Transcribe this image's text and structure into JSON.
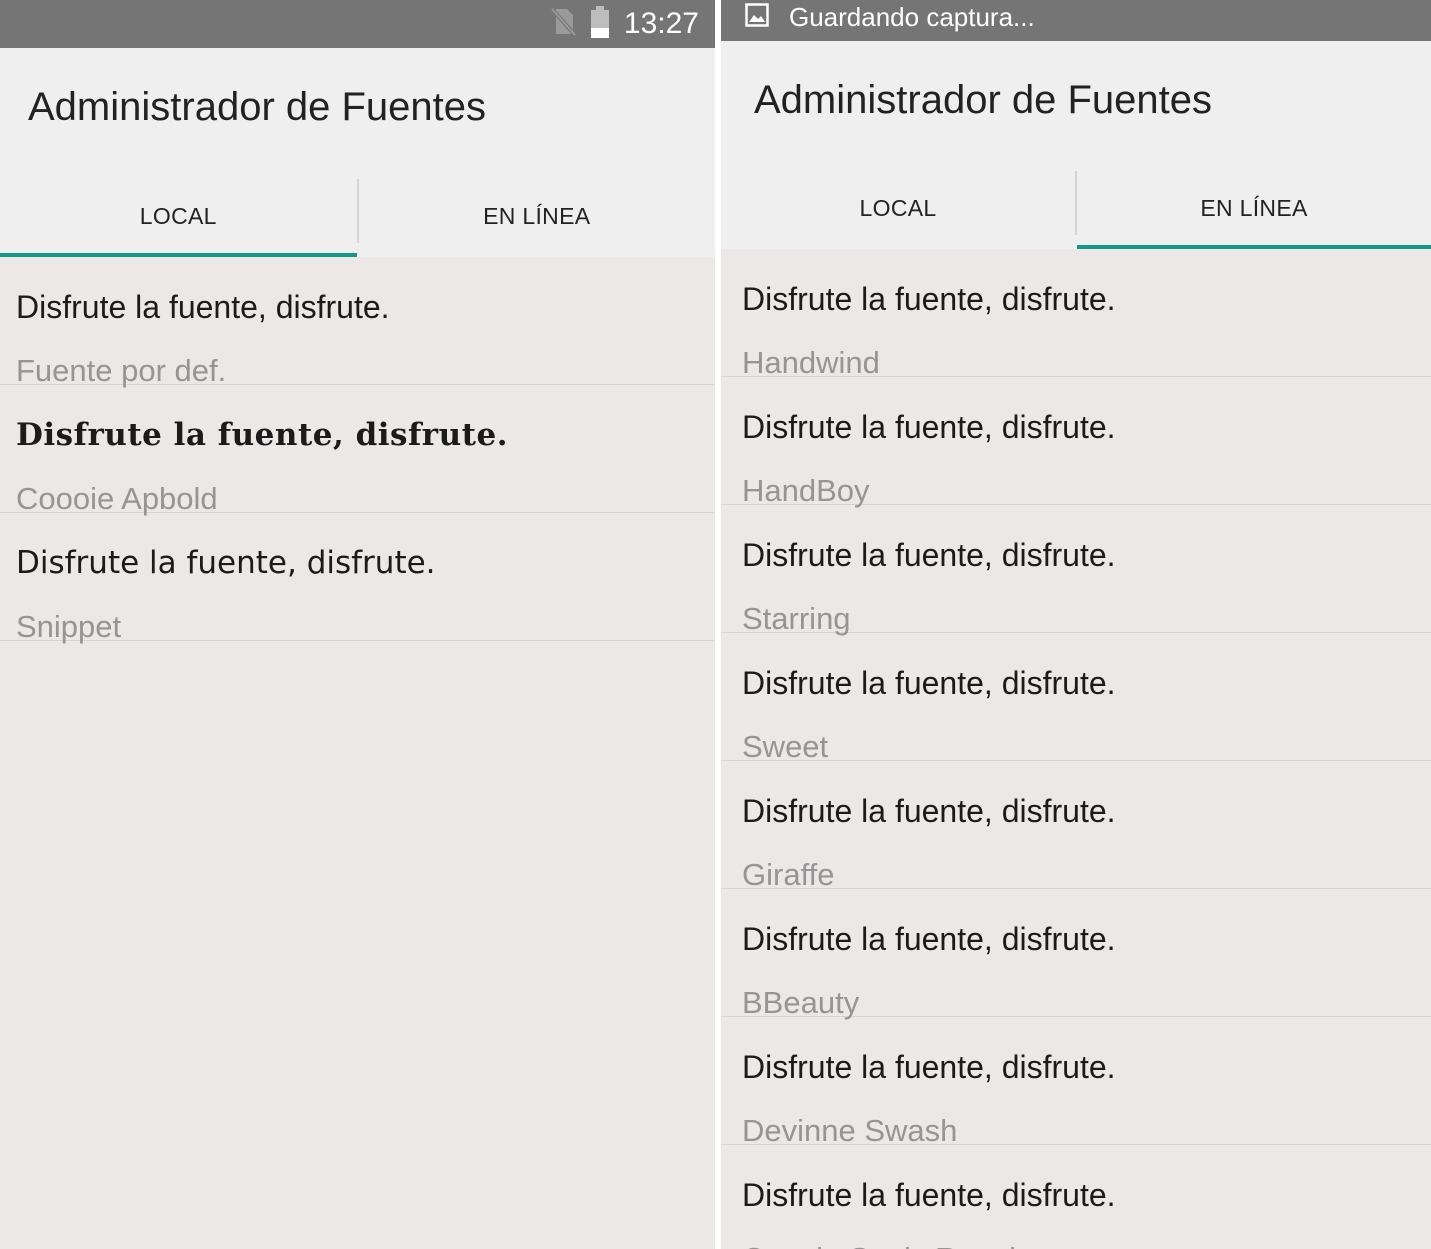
{
  "left": {
    "status": {
      "time": "13:27"
    },
    "app_title": "Administrador de Fuentes",
    "tabs": [
      {
        "label": "LOCAL",
        "active": true
      },
      {
        "label": "EN LÍNEA",
        "active": false
      }
    ],
    "fonts": [
      {
        "sample": "Disfrute la fuente, disfrute.",
        "name": "Fuente por def."
      },
      {
        "sample": "Disfrute la fuente, disfrute.",
        "name": "Coooie Apbold"
      },
      {
        "sample": "Disfrute la fuente, disfrute.",
        "name": "Snippet"
      }
    ]
  },
  "right": {
    "notification": {
      "text": "Guardando captura..."
    },
    "app_title": "Administrador de Fuentes",
    "tabs": [
      {
        "label": "LOCAL",
        "active": false
      },
      {
        "label": "EN LÍNEA",
        "active": true
      }
    ],
    "fonts": [
      {
        "sample": "Disfrute la fuente, disfrute.",
        "name": "Handwind"
      },
      {
        "sample": "Disfrute la fuente, disfrute.",
        "name": "HandBoy"
      },
      {
        "sample": "Disfrute la fuente, disfrute.",
        "name": "Starring"
      },
      {
        "sample": "Disfrute la fuente, disfrute.",
        "name": "Sweet"
      },
      {
        "sample": "Disfrute la fuente, disfrute.",
        "name": "Giraffe"
      },
      {
        "sample": "Disfrute la fuente, disfrute.",
        "name": "BBeauty"
      },
      {
        "sample": "Disfrute la fuente, disfrute.",
        "name": "Devinne Swash"
      },
      {
        "sample": "Disfrute la fuente, disfrute.",
        "name": "Coooie Sauls Regular"
      }
    ]
  },
  "colors": {
    "accent": "#149688",
    "statusbar": "#757575",
    "background": "#ece8e7",
    "appbar": "#efefef"
  },
  "icons": {
    "status": [
      "no-sim-icon",
      "battery-icon"
    ],
    "notification": "image-icon"
  }
}
